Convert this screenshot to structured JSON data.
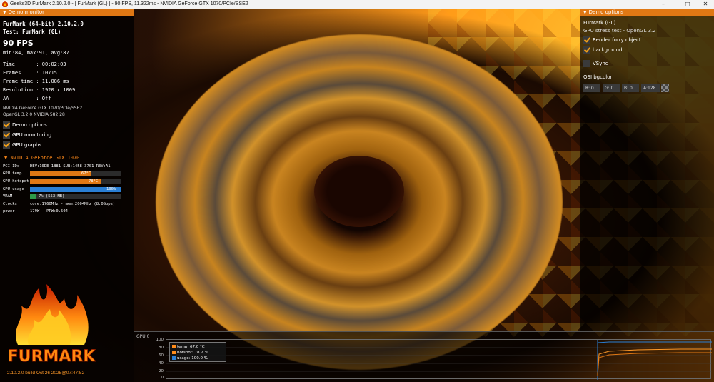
{
  "titlebar": {
    "title": "Geeks3D FurMark 2.10.2.0 - [ FurMark (GL) ] - 90 FPS, 11.322ms - NVIDIA GeForce GTX 1070/PCIe/SSE2",
    "minimize": "–",
    "maximize": "□",
    "close": "✕"
  },
  "left_panel": {
    "header": "Demo monitor",
    "app_name": "FurMark (64-bit) 2.10.2.0",
    "test": "Test: FurMark (GL)",
    "fps": "90 FPS",
    "fps_stats": "min:84, max:91, avg:87",
    "stats": [
      {
        "label": "Time       :",
        "value": "00:02:03"
      },
      {
        "label": "Frames     :",
        "value": "10715"
      },
      {
        "label": "Frame time :",
        "value": "11.086 ms"
      },
      {
        "label": "Resolution :",
        "value": "1920 x 1009"
      },
      {
        "label": "AA         :",
        "value": "Off"
      }
    ],
    "renderer": "NVIDIA GeForce GTX 1070/PCIe/SSE2",
    "opengl": "OpenGL 3.2.0 NVIDIA 582.28",
    "checkboxes": [
      {
        "label": "Demo options",
        "checked": true
      },
      {
        "label": "GPU monitoring",
        "checked": true
      },
      {
        "label": "GPU graphs",
        "checked": true
      }
    ],
    "gpu_title": "NVIDIA GeForce GTX 1070",
    "pci_label": "PCI IDs",
    "pci_value": "DEV:10DE-1B81 SUB:1458-3701 REV:A1",
    "gpu_temp_label": "GPU temp",
    "gpu_temp_value": "67°C",
    "gpu_temp_fraction": 0.67,
    "gpu_hotspot_label": "GPU hotspot",
    "gpu_hotspot_value": "78°C",
    "gpu_hotspot_fraction": 0.78,
    "gpu_usage_label": "GPU usage",
    "gpu_usage_value": "100%",
    "gpu_usage_fraction": 1.0,
    "vram_label": "VRAM",
    "vram_value": "7% (553 MB)",
    "vram_fraction": 0.07,
    "clocks_label": "Clocks",
    "clocks_value": "core:1760MHz - mem:2004MHz (8.0Gbps)",
    "power_label": "power",
    "power_value": "179W - PPW:0.504",
    "logo_text": "FURMARK",
    "build": "2.10.2.0 build Oct 26 2025@07:47:52"
  },
  "right_panel": {
    "header": "Demo options",
    "demo_name": "FurMark (GL)",
    "demo_desc": "GPU stress test - OpenGL 3.2",
    "checkboxes": [
      {
        "label": "Render furry object",
        "checked": true
      },
      {
        "label": "background",
        "checked": true
      }
    ],
    "vsync_label": "VSync",
    "vsync_checked": false,
    "osi_label": "OSI bgcolor",
    "r": "R: 0",
    "g": "G: 0",
    "b": "B: 0",
    "a": "A:128"
  },
  "graph": {
    "title": "GPU 0",
    "y_ticks": [
      "100",
      "80",
      "60",
      "40",
      "20",
      "0"
    ],
    "legend": [
      {
        "label": "temp: 67.0 °C",
        "color": "#ff8c1a"
      },
      {
        "label": "hotspot: 78.2 °C",
        "color": "#ff8c1a"
      },
      {
        "label": "usage: 100.0 %",
        "color": "#2a7fd4"
      }
    ]
  },
  "colors": {
    "accent": "#e07814",
    "temp_bar": "#e07814",
    "usage_bar": "#2a7fd4",
    "vram_bar": "#2e9a4a"
  }
}
